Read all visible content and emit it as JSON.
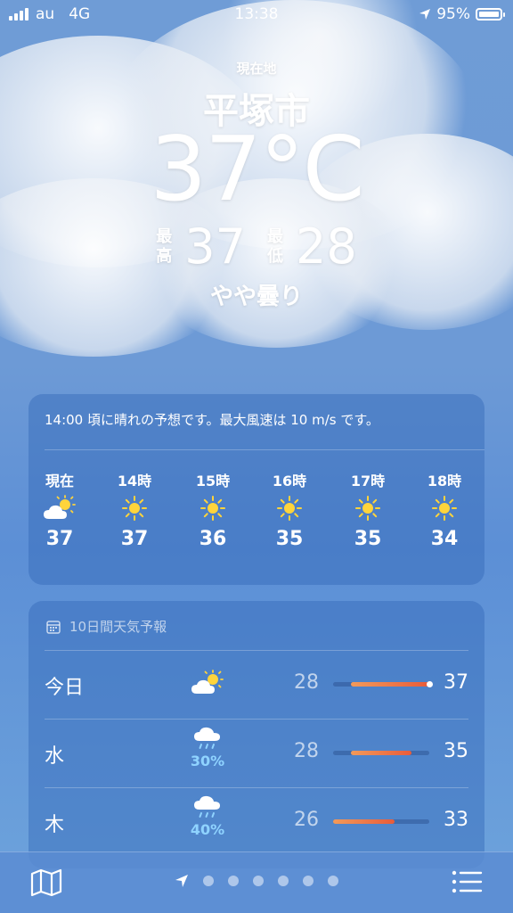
{
  "status_bar": {
    "carrier": "au",
    "network": "4G",
    "time": "13:38",
    "battery": "95%"
  },
  "location": {
    "label": "現在地",
    "city": "平塚市",
    "temperature": "37°C",
    "high_label": "最高",
    "high": "37",
    "low_label": "最低",
    "low": "28",
    "condition": "やや曇り"
  },
  "hourly": {
    "summary": "14:00 頃に晴れの予想です。最大風速は 10 m/s です。",
    "items": [
      {
        "time": "現在",
        "icon": "partly-cloudy-icon",
        "temp": "37"
      },
      {
        "time": "14時",
        "icon": "sun-icon",
        "temp": "37"
      },
      {
        "time": "15時",
        "icon": "sun-icon",
        "temp": "36"
      },
      {
        "time": "16時",
        "icon": "sun-icon",
        "temp": "35"
      },
      {
        "time": "17時",
        "icon": "sun-icon",
        "temp": "35"
      },
      {
        "time": "18時",
        "icon": "sun-icon",
        "temp": "34"
      }
    ]
  },
  "daily": {
    "header": "10日間天気予報",
    "range": {
      "min": 26,
      "max": 37
    },
    "items": [
      {
        "day": "今日",
        "icon": "partly-cloudy-icon",
        "precip": "",
        "low": "28",
        "high": "37",
        "current": 37
      },
      {
        "day": "水",
        "icon": "rain-cloud-icon",
        "precip": "30%",
        "low": "28",
        "high": "35"
      },
      {
        "day": "木",
        "icon": "rain-cloud-icon",
        "precip": "40%",
        "low": "26",
        "high": "33"
      }
    ]
  },
  "tab_bar": {
    "page_count": 6,
    "colors": {
      "temp_bar_start": "#f29a5a",
      "temp_bar_end": "#e85c3a",
      "precip": "#8fd3ff"
    }
  }
}
